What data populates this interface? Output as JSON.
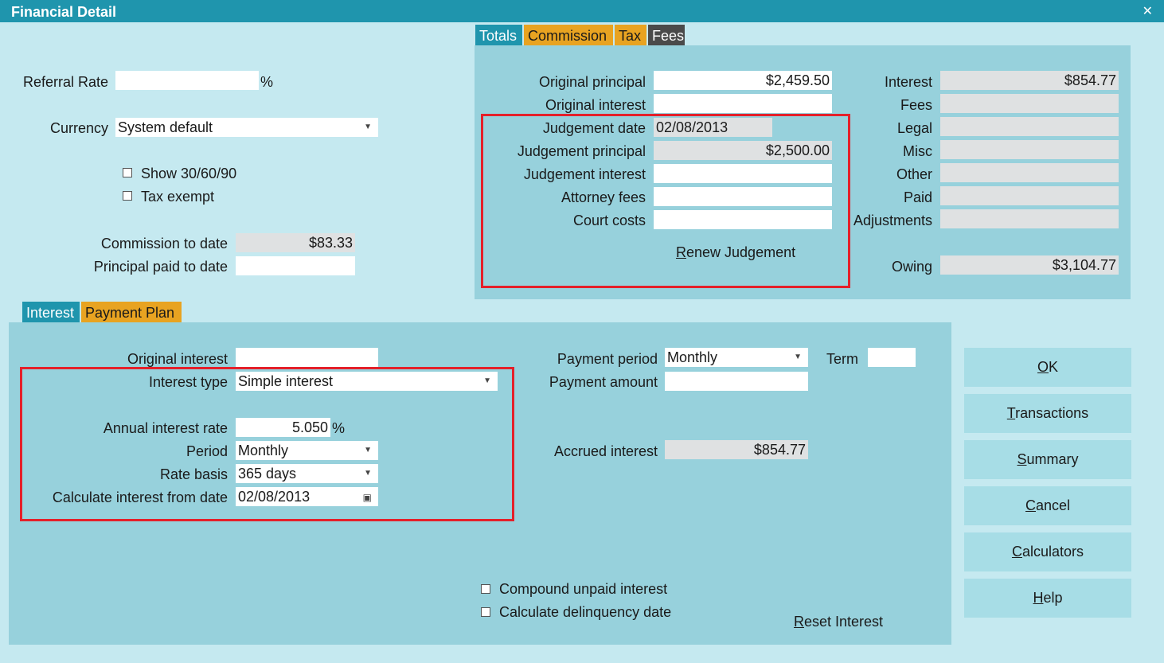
{
  "window": {
    "title": "Financial Detail",
    "close_glyph": "✕"
  },
  "left": {
    "referral_rate_label": "Referral Rate",
    "referral_rate_value": "",
    "percent": "%",
    "currency_label": "Currency",
    "currency_value": "System default",
    "show_306090_label": "Show 30/60/90",
    "tax_exempt_label": "Tax exempt",
    "commission_to_date_label": "Commission to date",
    "commission_to_date_value": "$83.33",
    "principal_paid_label": "Principal paid to date",
    "principal_paid_value": ""
  },
  "top_tabs": [
    {
      "label": "Totals"
    },
    {
      "label": "Commission"
    },
    {
      "label": "Tax"
    },
    {
      "label": "Fees"
    }
  ],
  "totals": {
    "original_principal_label": "Original principal",
    "original_principal_value": "$2,459.50",
    "original_interest_label": "Original interest",
    "original_interest_value": "",
    "judgement_date_label": "Judgement date",
    "judgement_date_value": "02/08/2013",
    "judgement_principal_label": "Judgement principal",
    "judgement_principal_value": "$2,500.00",
    "judgement_interest_label": "Judgement interest",
    "judgement_interest_value": "",
    "attorney_fees_label": "Attorney fees",
    "attorney_fees_value": "",
    "court_costs_label": "Court costs",
    "court_costs_value": "",
    "renew_judgement_first": "R",
    "renew_judgement_rest": "enew Judgement",
    "interest_label": "Interest",
    "interest_value": "$854.77",
    "fees_label": "Fees",
    "legal_label": "Legal",
    "misc_label": "Misc",
    "other_label": "Other",
    "paid_label": "Paid",
    "adjustments_label": "Adjustments",
    "owing_label": "Owing",
    "owing_value": "$3,104.77"
  },
  "bottom_tabs": [
    {
      "label": "Interest"
    },
    {
      "label": "Payment Plan"
    }
  ],
  "interest": {
    "original_interest_label": "Original interest",
    "original_interest_value": "",
    "interest_type_label": "Interest type",
    "interest_type_value": "Simple interest",
    "annual_rate_label": "Annual interest rate",
    "annual_rate_value": "5.050",
    "percent": "%",
    "period_label": "Period",
    "period_value": "Monthly",
    "rate_basis_label": "Rate basis",
    "rate_basis_value": "365 days",
    "calc_from_label": "Calculate interest from date",
    "calc_from_value": "02/08/2013",
    "payment_period_label": "Payment period",
    "payment_period_value": "Monthly",
    "term_label": "Term",
    "term_value": "",
    "payment_amount_label": "Payment amount",
    "payment_amount_value": "",
    "accrued_interest_label": "Accrued interest",
    "accrued_interest_value": "$854.77",
    "compound_label": "Compound unpaid interest",
    "delinquency_label": "Calculate delinquency date",
    "reset_first": "R",
    "reset_rest": "eset Interest"
  },
  "buttons": [
    {
      "first": "O",
      "rest": "K"
    },
    {
      "first": "T",
      "rest": "ransactions"
    },
    {
      "first": "S",
      "rest": "ummary"
    },
    {
      "first": "C",
      "rest": "ancel"
    },
    {
      "first": "C",
      "rest": "alculators"
    },
    {
      "first": "H",
      "rest": "elp"
    }
  ],
  "colors": {
    "background": "#c5e9f0",
    "panel": "#97d1dc",
    "titlebar": "#1f95ad",
    "tab_orange": "#e8a321",
    "tab_dark": "#4a4a4a",
    "highlight_box": "#e4202a"
  }
}
